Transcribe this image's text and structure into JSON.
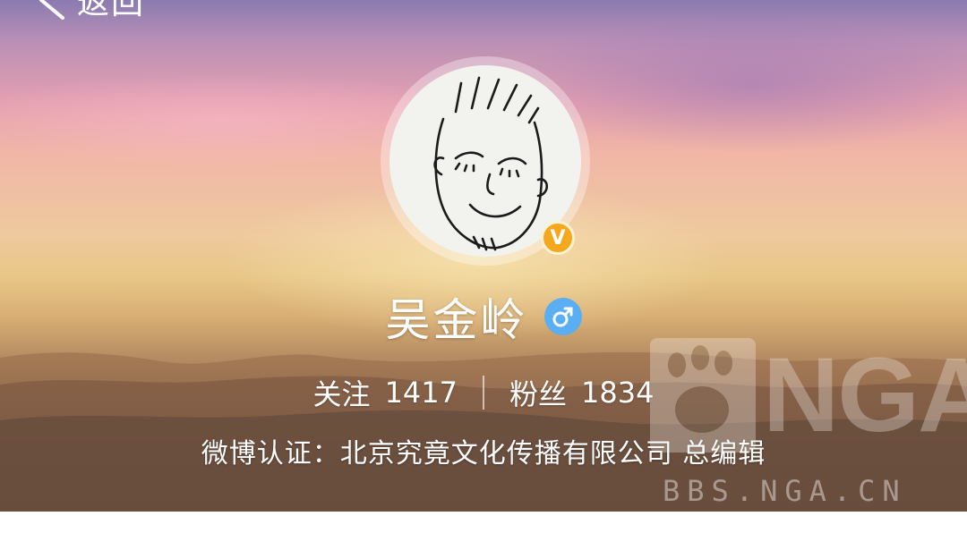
{
  "header": {
    "back_label": "返回"
  },
  "profile": {
    "name": "吴金岭",
    "verified_badge": "V",
    "gender_symbol": "♂",
    "following_label": "关注",
    "following_count": "1417",
    "followers_label": "粉丝",
    "followers_count": "1834",
    "certification": "微博认证：北京究竟文化传播有限公司 总编辑"
  },
  "watermark": {
    "logo_text": "NGA",
    "url": "BBS.NGA.CN"
  },
  "colors": {
    "verified": "#f5a81e",
    "gender": "#5aaef3"
  }
}
